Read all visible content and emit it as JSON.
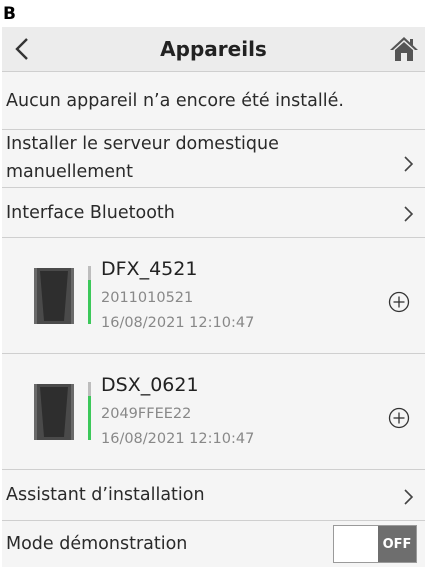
{
  "figure_label": "B",
  "header": {
    "title": "Appareils"
  },
  "info": {
    "message": "Aucun appareil n’a encore été installé."
  },
  "menu": {
    "install_manual": "Installer le serveur domestique manuellement",
    "bluetooth": "Interface Bluetooth",
    "assistant": "Assistant d’installation",
    "demo_mode": "Mode démonstration"
  },
  "devices": [
    {
      "name": "DFX_4521",
      "serial": "2011010521",
      "datetime": "16/08/2021 12:10:47"
    },
    {
      "name": "DSX_0621",
      "serial": "2049FFEE22",
      "datetime": "16/08/2021 12:10:47"
    }
  ],
  "demo_toggle": {
    "state_label": "OFF",
    "on": false
  },
  "colors": {
    "background": "#f5f5f5",
    "titlebar": "#ececec",
    "status_green": "#3cc85a",
    "toggle_off": "#6e6e6e"
  }
}
